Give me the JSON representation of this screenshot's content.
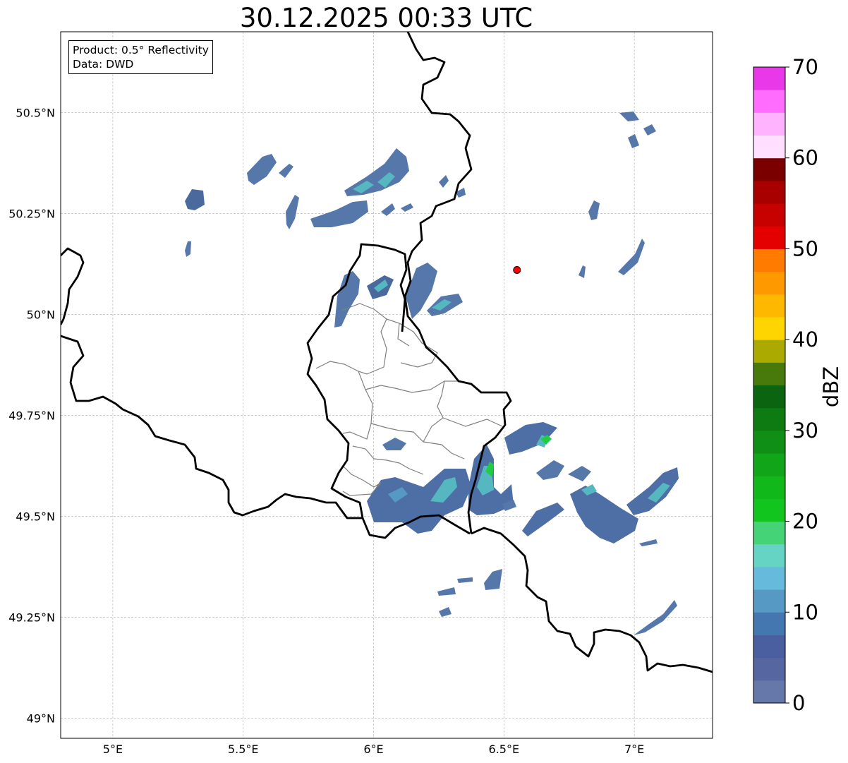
{
  "title": "30.12.2025 00:33 UTC",
  "info": {
    "product_line": "Product: 0.5° Reflectivity",
    "data_line": "Data: DWD"
  },
  "axes": {
    "lon_ticks": [
      {
        "value": 5.0,
        "label": "5°E"
      },
      {
        "value": 5.5,
        "label": "5.5°E"
      },
      {
        "value": 6.0,
        "label": "6°E"
      },
      {
        "value": 6.5,
        "label": "6.5°E"
      },
      {
        "value": 7.0,
        "label": "7°E"
      }
    ],
    "lat_ticks": [
      {
        "value": 49.0,
        "label": "49°N"
      },
      {
        "value": 49.25,
        "label": "49.25°N"
      },
      {
        "value": 49.5,
        "label": "49.5°N"
      },
      {
        "value": 49.75,
        "label": "49.75°N"
      },
      {
        "value": 50.0,
        "label": "50°N"
      },
      {
        "value": 50.25,
        "label": "50.25°N"
      },
      {
        "value": 50.5,
        "label": "50.5°N"
      }
    ],
    "lon_range": [
      4.8,
      7.3
    ],
    "lat_range": [
      48.95,
      50.7
    ],
    "grid": true
  },
  "colorbar": {
    "label": "dBZ",
    "min": 0,
    "max": 70,
    "tick_labels": [
      "0",
      "10",
      "20",
      "30",
      "40",
      "50",
      "60",
      "70"
    ],
    "colors": [
      "#6677aa",
      "#5566a0",
      "#4a5fa0",
      "#4477b0",
      "#5599c4",
      "#66bbdd",
      "#66d4c4",
      "#44d477",
      "#11c41e",
      "#11b81a",
      "#11a51a",
      "#0f8f15",
      "#0d7a12",
      "#0b6510",
      "#477a0a",
      "#aaaa00",
      "#ffd500",
      "#ffb800",
      "#ff9900",
      "#ff7b00",
      "#e50000",
      "#c70000",
      "#a80000",
      "#7a0000",
      "#ffe0ff",
      "#ffb3ff",
      "#ff6dff",
      "#e838e8"
    ]
  },
  "radar_site": {
    "lon": 6.55,
    "lat": 50.11,
    "color": "#ff0000"
  }
}
